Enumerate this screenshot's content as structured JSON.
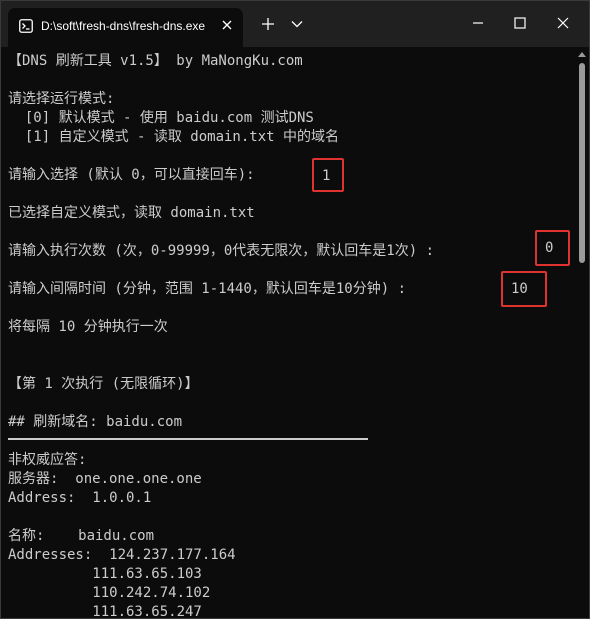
{
  "window": {
    "tab_title": "D:\\soft\\fresh-dns\\fresh-dns.exe",
    "icons": {
      "tab": "terminal-icon",
      "close_tab": "close-icon",
      "new_tab": "plus-icon",
      "dropdown": "chevron-down-icon",
      "minimize": "minimize-icon",
      "maximize": "maximize-icon",
      "close_window": "close-icon"
    }
  },
  "terminal": {
    "colors": {
      "background": "#0c0c0c",
      "text": "#cccccc",
      "highlight_box": "#e0322f"
    },
    "header": "【DNS 刷新工具 v1.5】 by MaNongKu.com",
    "mode_prompt": "请选择运行模式:",
    "mode_option_0": "  [0] 默认模式 - 使用 baidu.com 测试DNS",
    "mode_option_1": "  [1] 自定义模式 - 读取 domain.txt 中的域名",
    "choice_prompt": "请输入选择 (默认 0，可以直接回车):",
    "choice_value": "1",
    "selected_msg": "已选择自定义模式，读取 domain.txt",
    "count_prompt": "请输入执行次数 (次，0-99999，0代表无限次，默认回车是1次) :",
    "count_value": "0",
    "interval_prompt": "请输入间隔时间 (分钟，范围 1-1440，默认回车是10分钟) :",
    "interval_value": "10",
    "schedule_msg": "将每隔 10 分钟执行一次",
    "run_header": "【第 1 次执行 (无限循环)】",
    "domain_header": "## 刷新域名: baidu.com",
    "nonauth": "非权威应答:",
    "server_line": "服务器:  one.one.one.one",
    "address_line": "Address:  1.0.0.1",
    "name_line": "名称:    baidu.com",
    "addresses_line": "Addresses:  124.237.177.164",
    "address_extra": [
      "          111.63.65.103",
      "          110.242.74.102",
      "          111.63.65.247"
    ]
  }
}
